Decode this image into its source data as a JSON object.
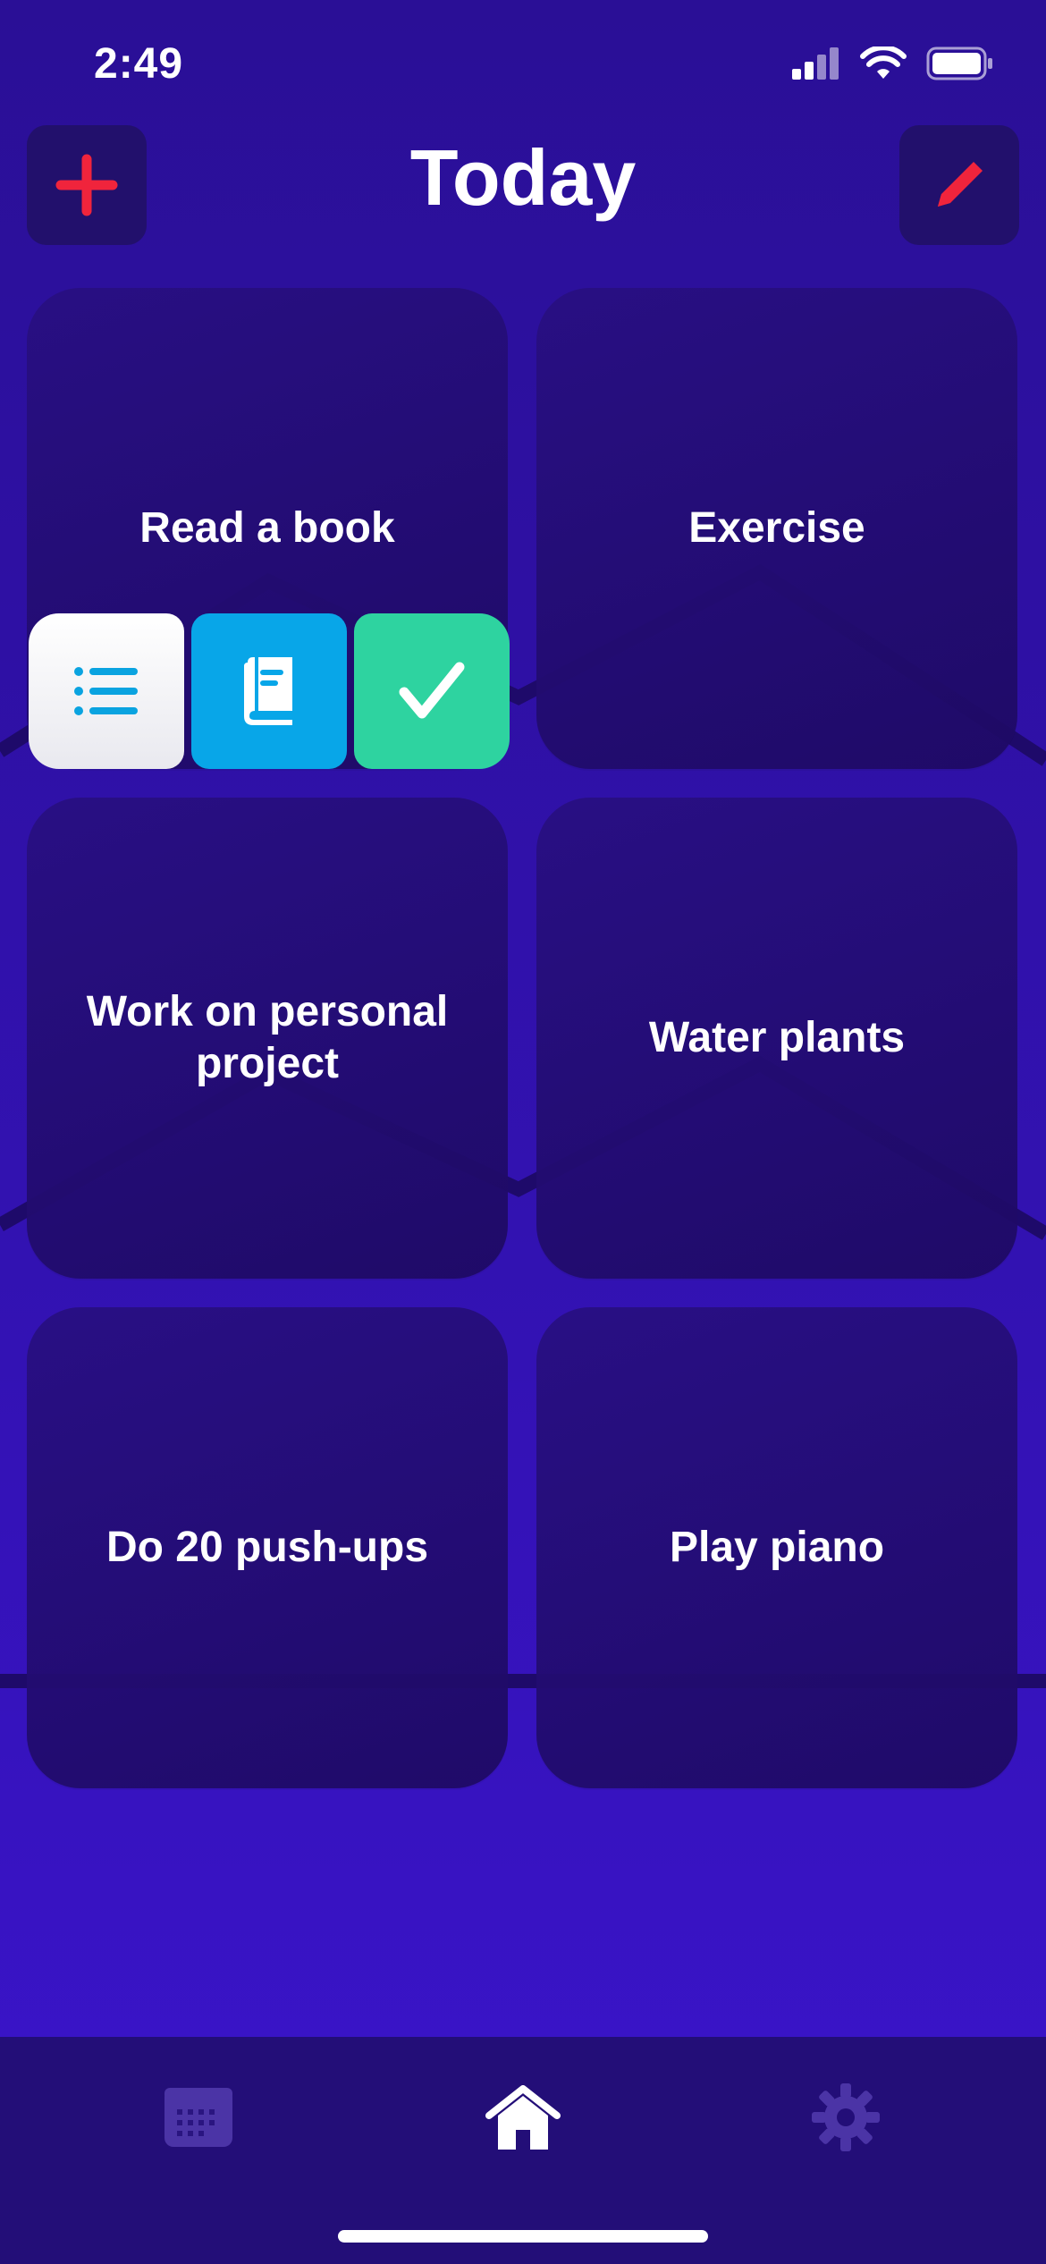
{
  "status_bar": {
    "time": "2:49"
  },
  "header": {
    "title": "Today"
  },
  "cards": [
    {
      "label": "Read a book"
    },
    {
      "label": "Exercise"
    },
    {
      "label": "Work on personal project"
    },
    {
      "label": "Water plants"
    },
    {
      "label": "Do 20 push-ups"
    },
    {
      "label": "Play piano"
    }
  ],
  "actions": [
    "list-icon",
    "book-icon",
    "checkmark-icon"
  ],
  "tabs": [
    "calendar-icon",
    "home-icon",
    "gear-icon"
  ],
  "colors": {
    "accent_red": "#f0243c",
    "action_blue": "#08a6e8",
    "action_green": "#2ed3a0",
    "background": "#3312b4"
  }
}
